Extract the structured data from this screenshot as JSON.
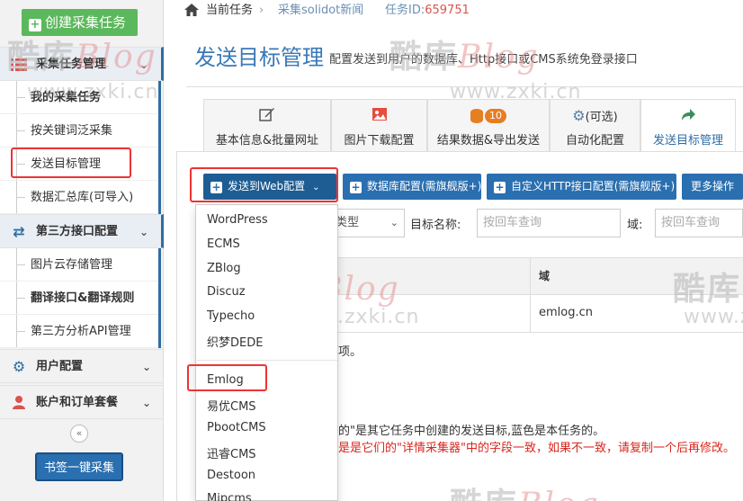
{
  "sidebar": {
    "create_button": "创建采集任务",
    "groups": [
      {
        "label": "采集任务管理",
        "icon": "list-icon"
      },
      {
        "label": "第三方接口配置",
        "icon": "exchange-icon"
      },
      {
        "label": "用户配置",
        "icon": "gear-icon"
      },
      {
        "label": "账户和订单套餐",
        "icon": "user-icon"
      }
    ],
    "task_items": [
      "我的采集任务",
      "按关键词泛采集",
      "发送目标管理",
      "数据汇总库(可导入)"
    ],
    "api_items": [
      "图片云存储管理",
      "翻译接口&翻译规则",
      "第三方分析API管理"
    ],
    "collapse_label": "«",
    "bookmark_button": "书签一键采集"
  },
  "breadcrumb": {
    "current": "当前任务",
    "separator": "›",
    "task_name": "采集solidot新闻",
    "task_id_label": "任务ID:",
    "task_id": "659751"
  },
  "header": {
    "title": "发送目标管理",
    "subtitle": "配置发送到用户的数据库、Http接口或CMS系统免登录接口"
  },
  "tabs": [
    {
      "label": "基本信息&批量网址",
      "icon": "edit-icon"
    },
    {
      "label": "图片下载配置",
      "icon": "image-icon"
    },
    {
      "label": "结果数据&导出发送",
      "icon": "database-icon",
      "badge": "10"
    },
    {
      "label": "自动化配置",
      "icon": "cogs-icon",
      "extra": "(可选)"
    },
    {
      "label": "发送目标管理",
      "icon": "share-icon",
      "active": true
    }
  ],
  "toolbar": {
    "web_config": "发送到Web配置",
    "db_config": "数据库配置(需旗舰版+)",
    "http_config": "自定义HTTP接口配置(需旗舰版+)",
    "more": "更多操作"
  },
  "filters": {
    "type_value": "类型",
    "name_label": "目标名称:",
    "name_placeholder": "按回车查询",
    "domain_label": "域:",
    "domain_placeholder": "按回车查询"
  },
  "table": {
    "domain_header": "域",
    "rows": [
      {
        "domain": "emlog.cn"
      }
    ]
  },
  "notes": {
    "note1": "项。",
    "note2": "的\"是其它任务中创建的发送目标,蓝色是本任务的。",
    "note3": "是是它们的\"详情采集器\"中的字段一致，如果不一致，请复制一个后再修改。"
  },
  "dropdown": {
    "items": [
      "WordPress",
      "ECMS",
      "ZBlog",
      "Discuz",
      "Typecho",
      "织梦DEDE",
      "Emlog",
      "易优CMS",
      "PbootCMS",
      "迅睿CMS",
      "Destoon",
      "Mipcms"
    ]
  },
  "watermark": {
    "text": "酷库",
    "blog": "Blog",
    "url": "www.zxki.cn"
  },
  "colors": {
    "accent": "#2a6fb0",
    "green": "#5cb85c",
    "highlight": "#e33333",
    "warning_text": "#d9251d"
  }
}
